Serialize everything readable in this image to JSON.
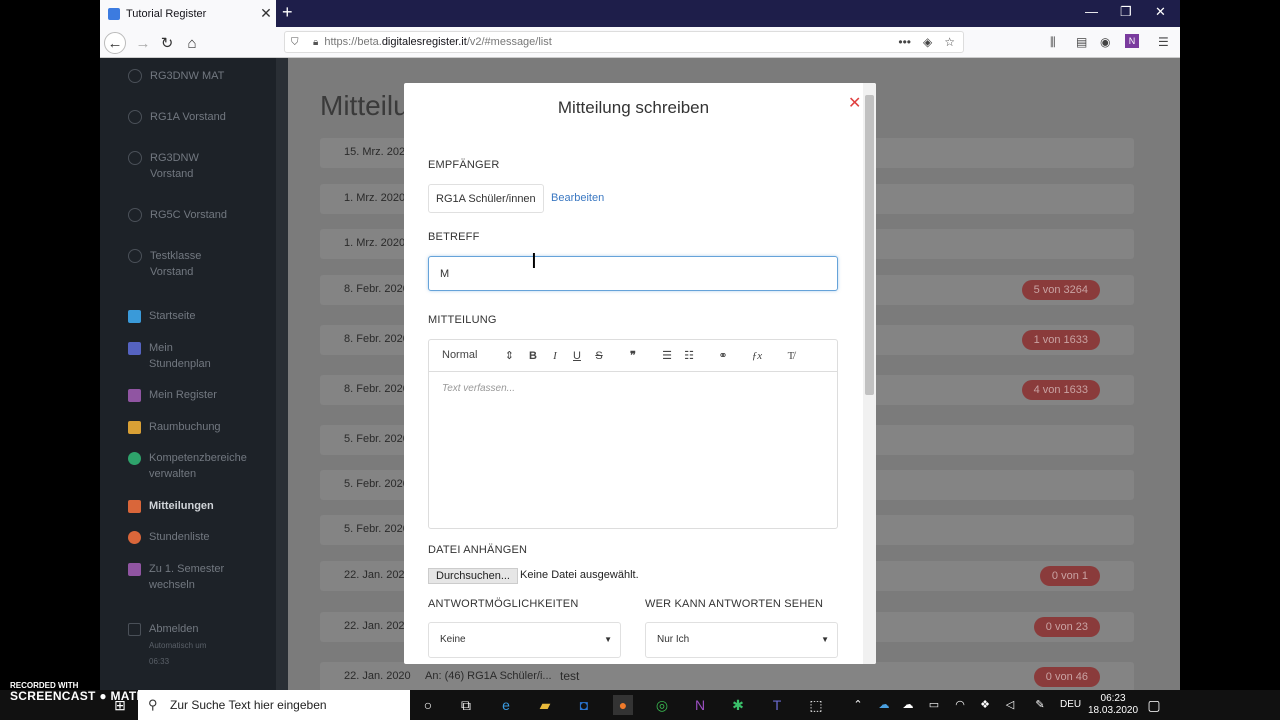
{
  "browser": {
    "tab_title": "Tutorial Register",
    "url_prefix": "https://beta.",
    "url_domain": "digitalesregister.it",
    "url_path": "/v2/#message/list"
  },
  "sidebar": {
    "groups": [
      "RG3DNW MAT",
      "RG1A Vorstand",
      "RG3DNW",
      "Vorstand",
      "RG5C Vorstand",
      "Testklasse",
      "Vorstand"
    ],
    "items": [
      {
        "label": "Startseite",
        "color": "#3a9ad9"
      },
      {
        "label": "Mein",
        "label2": "Stundenplan",
        "color": "#5563c1"
      },
      {
        "label": "Mein Register",
        "color": "#9055a2"
      },
      {
        "label": "Raumbuchung",
        "color": "#d9a035"
      },
      {
        "label": "Kompetenzbereiche",
        "label2": "verwalten",
        "color": "#2ea36b"
      },
      {
        "label": "Mitteilungen",
        "color": "#d9663a"
      },
      {
        "label": "Stundenliste",
        "color": "#d9663a"
      },
      {
        "label": "Zu 1. Semester",
        "label2": "wechseln",
        "color": "#9055a2"
      },
      {
        "label": "Abmelden",
        "sub1": "Automatisch um",
        "sub2": "06:33"
      }
    ]
  },
  "main": {
    "title": "Mitteilu",
    "rows": [
      {
        "date": "15. Mrz. 202",
        "badge": ""
      },
      {
        "date": "1. Mrz. 2020",
        "badge": ""
      },
      {
        "date": "1. Mrz. 2020",
        "badge": ""
      },
      {
        "date": "8. Febr. 2020",
        "badge": "5 von 3264"
      },
      {
        "date": "8. Febr. 2020",
        "badge": "1 von 1633"
      },
      {
        "date": "8. Febr. 2020",
        "badge": "4 von 1633"
      },
      {
        "date": "5. Febr. 2020",
        "badge": ""
      },
      {
        "date": "5. Febr. 2020",
        "badge": ""
      },
      {
        "date": "5. Febr. 2020",
        "badge": ""
      },
      {
        "date": "22. Jan. 2020",
        "badge": "0 von 1"
      },
      {
        "date": "22. Jan. 2020",
        "badge": "0 von 23"
      },
      {
        "date": "22. Jan. 2020",
        "to": "An: (46) RG1A Schüler/i...",
        "subject": "test",
        "badge": "0 von 46"
      }
    ]
  },
  "modal": {
    "title": "Mitteilung schreiben",
    "recipient_label": "EMPFÄNGER",
    "recipient": "RG1A Schüler/innen",
    "edit_label": "Bearbeiten",
    "subject_label": "BETREFF",
    "subject_value": "M",
    "message_label": "MITTEILUNG",
    "format": "Normal",
    "editor_placeholder": "Text verfassen...",
    "attach_label": "DATEI ANHÄNGEN",
    "browse_button": "Durchsuchen...",
    "file_status": "Keine Datei ausgewählt.",
    "reply_label": "ANTWORTMÖGLICHKEITEN",
    "reply_value": "Keine",
    "visibility_label": "WER KANN ANTWORTEN SEHEN",
    "visibility_value": "Nur Ich"
  },
  "taskbar": {
    "search_placeholder": "Zur Suche Text hier eingeben",
    "lang": "DEU",
    "time": "06:23",
    "date": "18.03.2020"
  },
  "watermark": {
    "line1": "RECORDED WITH",
    "line2": "SCREENCAST",
    "line3": "MATIC"
  }
}
